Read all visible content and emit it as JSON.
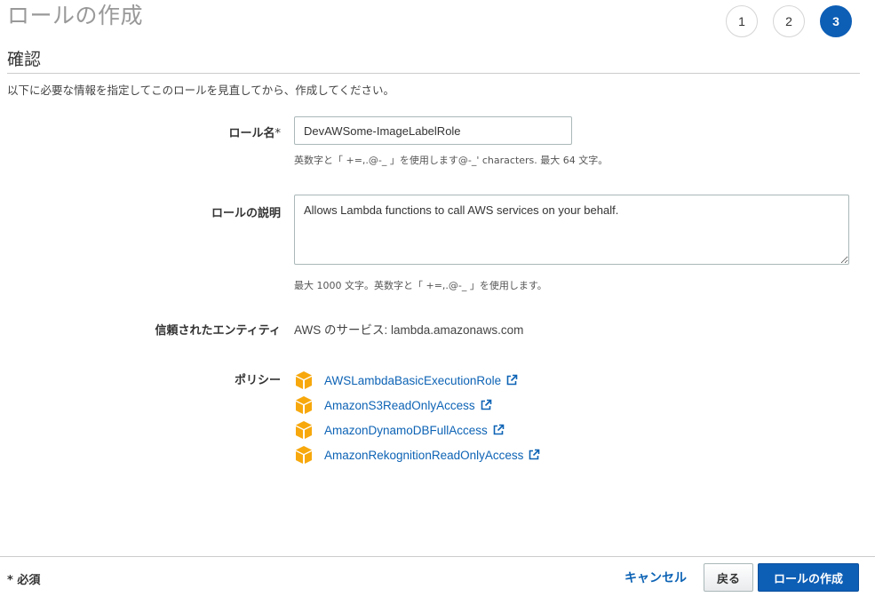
{
  "page": {
    "title": "ロールの作成",
    "steps": [
      "1",
      "2",
      "3"
    ],
    "active_step": "3"
  },
  "section": {
    "title": "確認",
    "instruction": "以下に必要な情報を指定してこのロールを見直してから、作成してください。"
  },
  "form": {
    "role_name_label": "ロール名",
    "required_mark": "*",
    "role_name_value": "DevAWSome-ImageLabelRole",
    "role_name_hint": "英数字と「 +=,.@-_ 」を使用します@-_' characters. 最大 64 文字。",
    "description_label": "ロールの説明",
    "description_value": "Allows Lambda functions to call AWS services on your behalf.",
    "description_hint": "最大 1000 文字。英数字と「 +=,.@-_ 」を使用します。",
    "trusted_label": "信頼されたエンティティ",
    "trusted_value": "AWS のサービス: lambda.amazonaws.com",
    "policies_label": "ポリシー",
    "policies": [
      "AWSLambdaBasicExecutionRole",
      "AmazonS3ReadOnlyAccess",
      "AmazonDynamoDBFullAccess",
      "AmazonRekognitionReadOnlyAccess"
    ]
  },
  "footer": {
    "required_note": "* 必須",
    "cancel_label": "キャンセル",
    "back_label": "戻る",
    "create_label": "ロールの作成"
  },
  "colors": {
    "primary": "#0d5eb5",
    "link": "#0d63b5",
    "policy_icon": "#f7a80d"
  }
}
